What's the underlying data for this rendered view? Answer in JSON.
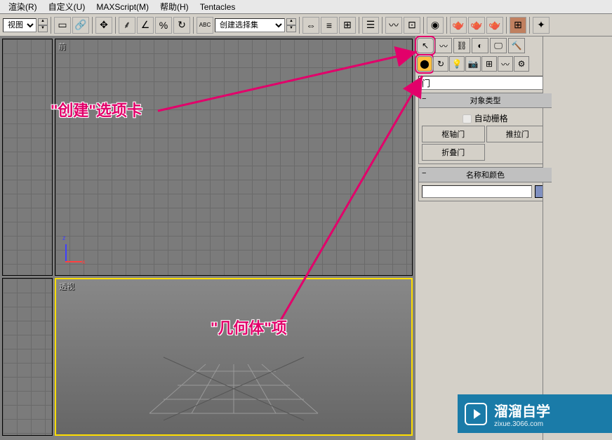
{
  "menu": {
    "render": "渲染(R)",
    "custom": "自定义(U)",
    "maxscript": "MAXScript(M)",
    "help": "帮助(H)",
    "tentacles": "Tentacles"
  },
  "toolbar": {
    "view_label": "视图",
    "selset_label": "创建选择集"
  },
  "viewports": {
    "front": "前",
    "persp": "透视"
  },
  "cmdpanel": {
    "category": "门",
    "rollout_objtype": "对象类型",
    "autogrid": "自动栅格",
    "btn_pivot": "枢轴门",
    "btn_sliding": "推拉门",
    "btn_bifold": "折叠门",
    "rollout_namecolor": "名称和颜色"
  },
  "annotations": {
    "create_tab": "\"创建\"选项卡",
    "geometry_item": "\"几何体\"项"
  },
  "watermark": {
    "brand": "溜溜自学",
    "url": "zixue.3066.com"
  },
  "icons": {
    "arrow": "↖",
    "link": "🔗",
    "move": "✥",
    "rotate": "↻",
    "scale": "▣",
    "select": "▭",
    "window": "▦",
    "snap": "⸙",
    "angle": "∠",
    "percent": "%",
    "grid": "⊞",
    "abc": "ABC",
    "mirror": "⇔",
    "align": "≡",
    "layer": "☰",
    "curve": "〰",
    "schematic": "⊡",
    "material": "◉",
    "render": "🫖",
    "quick": "🫖",
    "hammer": "🔨",
    "light": "💡",
    "camera": "📷",
    "helper": "✦",
    "space": "〰",
    "system": "⚙",
    "drop": "▾",
    "play": "▶",
    "hierarchy": "⛓",
    "motion": "◐",
    "display": "🖵",
    "util": "🔧",
    "sphere": "⬤"
  }
}
